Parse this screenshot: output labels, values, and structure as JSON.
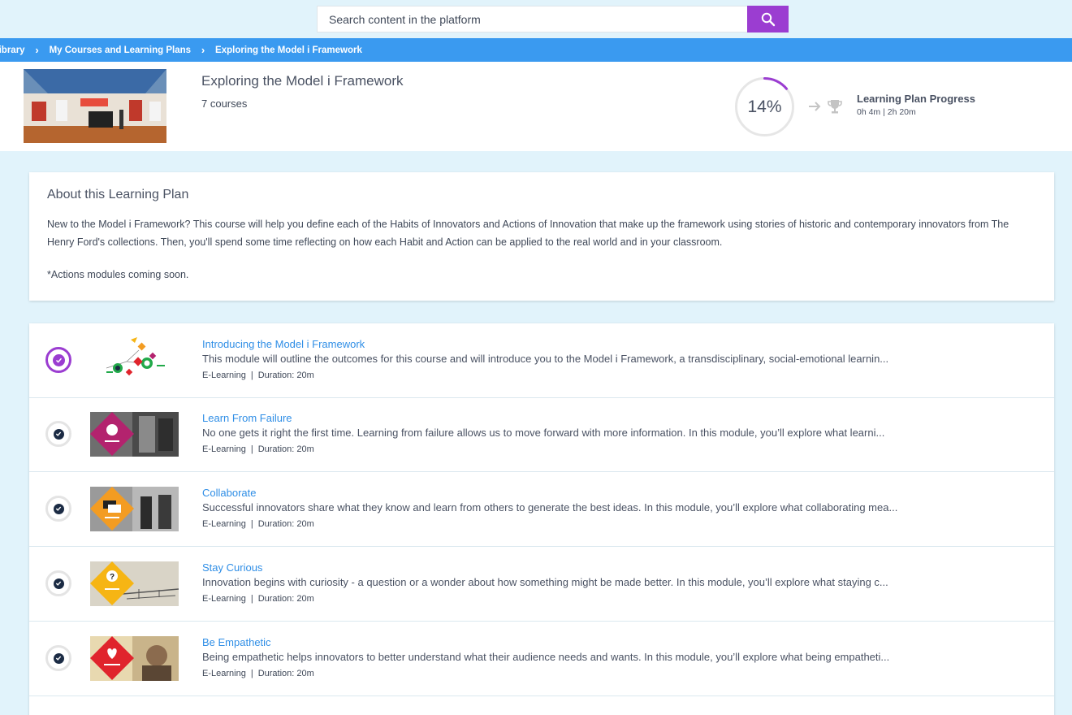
{
  "search": {
    "placeholder": "Search content in the platform"
  },
  "breadcrumb": {
    "items": [
      "e Library",
      "My Courses and Learning Plans",
      "Exploring the Model i Framework"
    ],
    "separator": "›"
  },
  "plan": {
    "title": "Exploring the Model i Framework",
    "course_count": "7 courses",
    "progress_percent": 14,
    "progress_label": "14%",
    "progress_title": "Learning Plan Progress",
    "progress_time": "0h 4m | 2h 20m"
  },
  "about": {
    "title": "About this Learning Plan",
    "text": "New to the Model i Framework? This course will help you define each of the Habits of Innovators and Actions of Innovation that make up the framework using stories of historic and contemporary innovators from The Henry Ford's collections. Then, you'll spend some time reflecting on how each Habit and Action can be applied to the real world and in your classroom.",
    "note": "*Actions modules coming soon."
  },
  "courses": [
    {
      "title": "Introducing the Model i Framework",
      "description": "This module will outline the outcomes for this course and will introduce you to the Model i Framework, a transdisciplinary, social-emotional learnin...",
      "type": "E-Learning",
      "duration": "Duration: 20m",
      "status": "in-progress",
      "thumb_color": "#ffffff"
    },
    {
      "title": "Learn From Failure",
      "description": "No one gets it right the first time. Learning from failure allows us to move forward with more information. In this module, you’ll explore what learni...",
      "type": "E-Learning",
      "duration": "Duration: 20m",
      "status": "completed",
      "thumb_color": "#b3236e"
    },
    {
      "title": "Collaborate",
      "description": "Successful innovators share what they know and learn from others to generate the best ideas. In this module, you’ll explore what collaborating mea...",
      "type": "E-Learning",
      "duration": "Duration: 20m",
      "status": "completed",
      "thumb_color": "#f39c22"
    },
    {
      "title": "Stay Curious",
      "description": "Innovation begins with curiosity - a question or a wonder about how something might be made better. In this module, you’ll explore what staying c...",
      "type": "E-Learning",
      "duration": "Duration: 20m",
      "status": "completed",
      "thumb_color": "#f6b514"
    },
    {
      "title": "Be Empathetic",
      "description": "Being empathetic helps innovators to better understand what their audience needs and wants. In this module, you’ll explore what being empatheti...",
      "type": "E-Learning",
      "duration": "Duration: 20m",
      "status": "completed",
      "thumb_color": "#e0242c"
    }
  ],
  "colors": {
    "accent": "#9b3dd1",
    "breadcrumb_bg": "#3a9af0",
    "link": "#2f8ee6",
    "page_bg": "#e1f3fb"
  }
}
